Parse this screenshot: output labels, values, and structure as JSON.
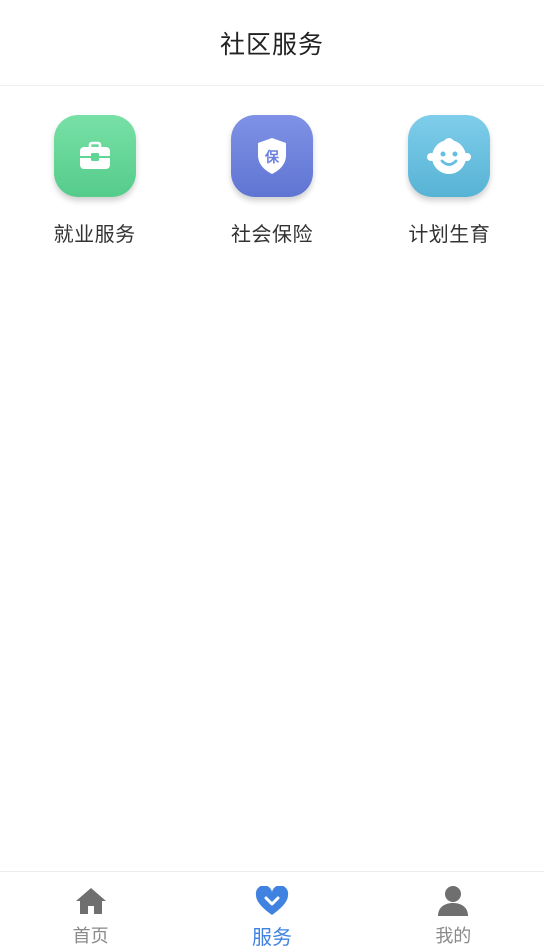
{
  "header": {
    "title": "社区服务"
  },
  "services": [
    {
      "label": "就业服务",
      "icon": "briefcase-icon",
      "color": "#5fd596"
    },
    {
      "label": "社会保险",
      "icon": "insurance-shield-icon",
      "badge": "保",
      "color": "#6b80dc"
    },
    {
      "label": "计划生育",
      "icon": "baby-face-icon",
      "color": "#66bfe0"
    }
  ],
  "tabbar": {
    "tabs": [
      {
        "label": "首页",
        "icon": "home-icon"
      },
      {
        "label": "服务",
        "icon": "heart-icon",
        "active": true
      },
      {
        "label": "我的",
        "icon": "person-icon"
      }
    ],
    "active_color": "#3f82e0",
    "inactive_color": "#8a8a8a"
  }
}
